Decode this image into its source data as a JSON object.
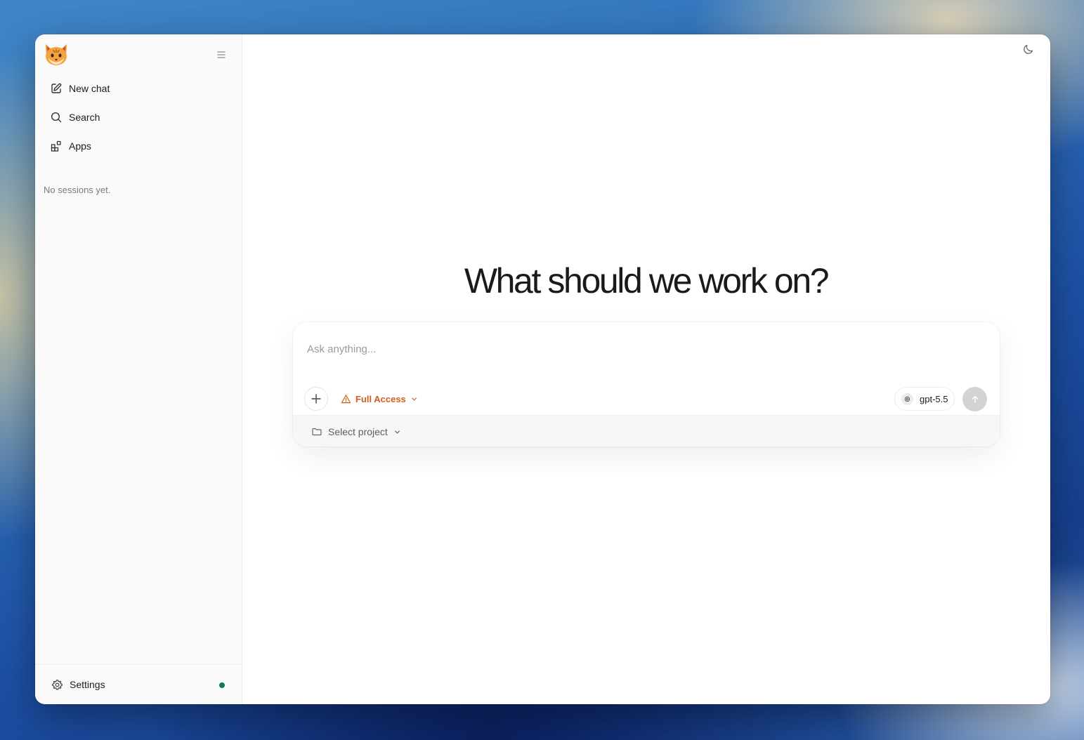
{
  "sidebar": {
    "items": [
      {
        "label": "New chat",
        "icon": "edit-icon"
      },
      {
        "label": "Search",
        "icon": "search-icon"
      },
      {
        "label": "Apps",
        "icon": "apps-icon"
      }
    ],
    "empty_text": "No sessions yet.",
    "settings_label": "Settings",
    "status_color": "#0f7a4f"
  },
  "main": {
    "heading": "What should we work on?"
  },
  "composer": {
    "placeholder": "Ask anything...",
    "access_label": "Full Access",
    "access_color": "#cf5f1d",
    "model_label": "gpt-5.5",
    "project_label": "Select project"
  }
}
